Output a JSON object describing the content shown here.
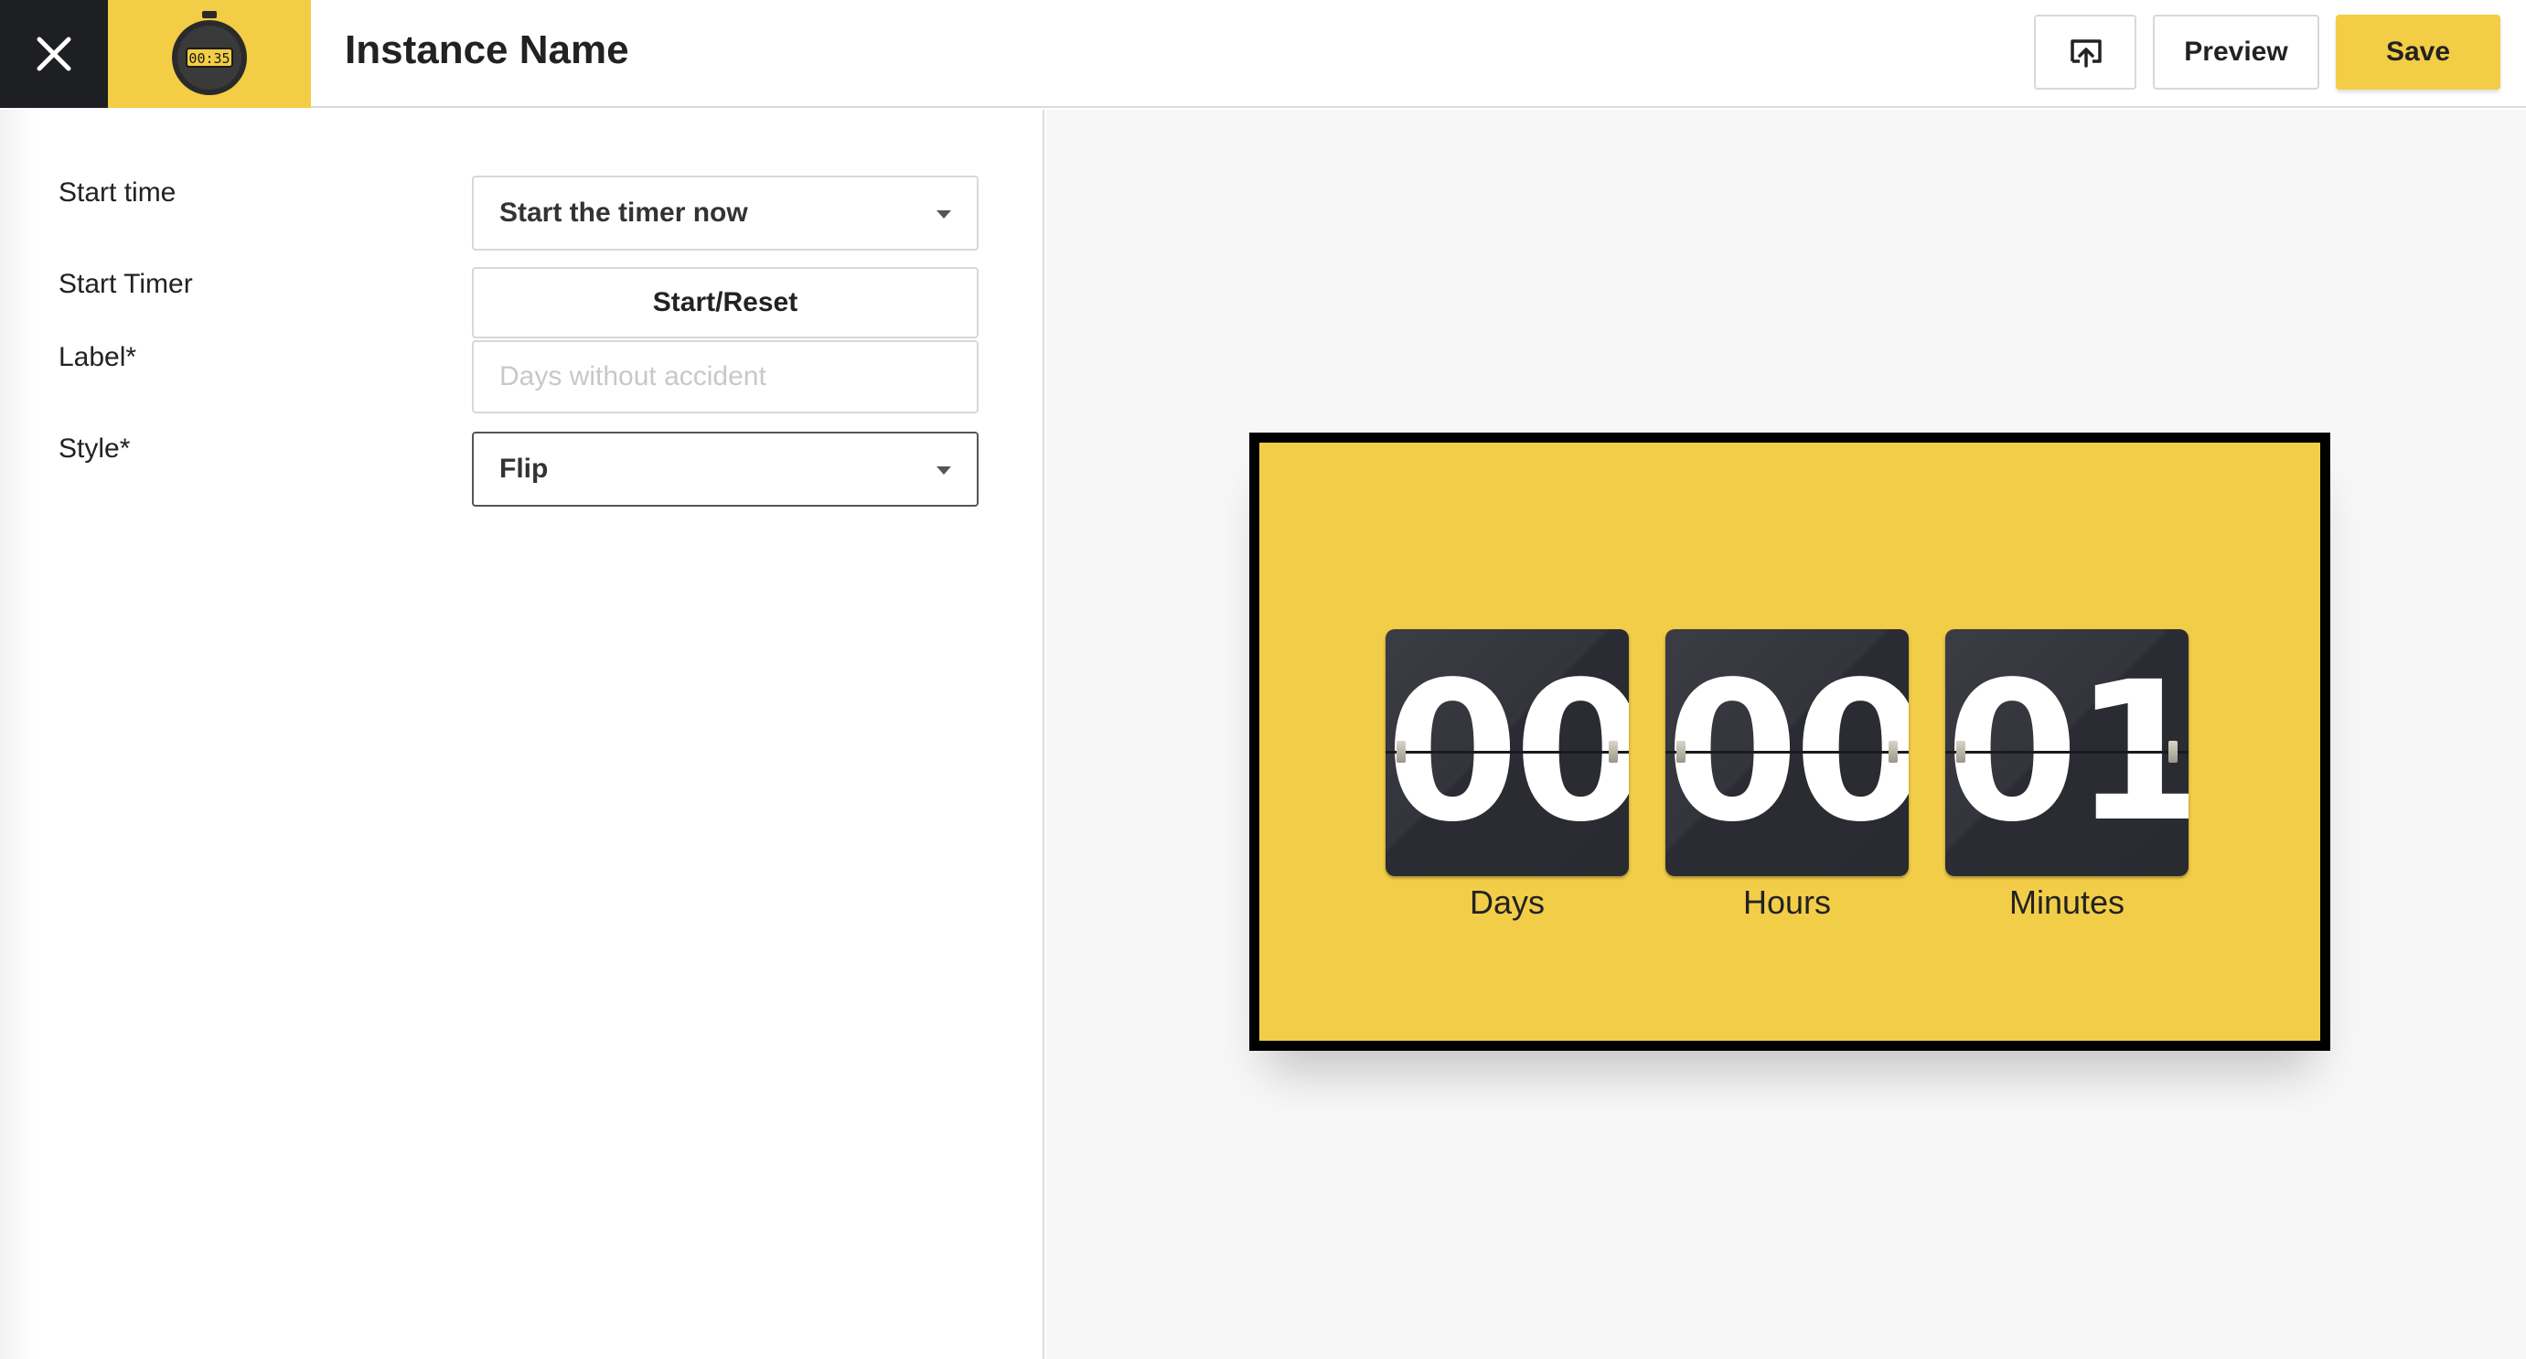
{
  "header": {
    "title": "Instance Name",
    "logo_text": "00:35",
    "buttons": {
      "preview_label": "Preview",
      "save_label": "Save"
    },
    "icons": {
      "close": "close-icon",
      "cast": "cast-icon",
      "logo": "stopwatch-icon"
    }
  },
  "form": {
    "start_time": {
      "label": "Start time",
      "value": "Start the timer now"
    },
    "start_timer": {
      "label": "Start Timer",
      "button_label": "Start/Reset"
    },
    "label_field": {
      "label": "Label*",
      "value": "",
      "placeholder": "Days without accident"
    },
    "style": {
      "label": "Style*",
      "value": "Flip"
    }
  },
  "preview": {
    "units": [
      {
        "value": "00",
        "label": "Days"
      },
      {
        "value": "00",
        "label": "Hours"
      },
      {
        "value": "01",
        "label": "Minutes"
      }
    ]
  },
  "colors": {
    "accent": "#f3cd45",
    "dark": "#1e1f22",
    "card": "#2e2f36"
  }
}
